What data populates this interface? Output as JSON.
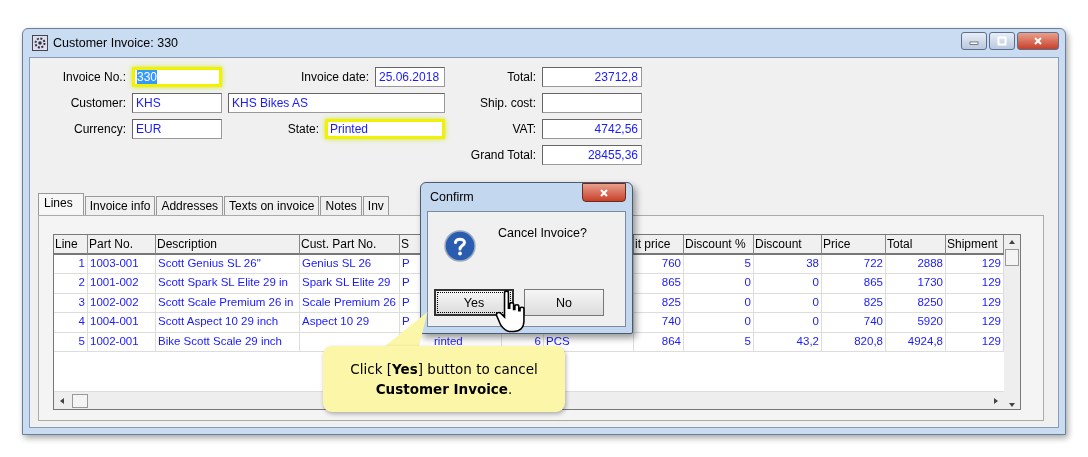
{
  "window": {
    "title": "Customer Invoice: 330"
  },
  "header": {
    "invoice_no": {
      "label": "Invoice No.:",
      "value": "330",
      "highlighted": true,
      "text_selected": true
    },
    "invoice_date": {
      "label": "Invoice date:",
      "value": "25.06.2018"
    },
    "customer": {
      "label": "Customer:",
      "code": "KHS",
      "name": "KHS Bikes AS"
    },
    "currency": {
      "label": "Currency:",
      "value": "EUR"
    },
    "state": {
      "label": "State:",
      "value": "Printed",
      "highlighted": true
    }
  },
  "totals": [
    {
      "label": "Total:",
      "value": "23712,8"
    },
    {
      "label": "Ship. cost:"
    },
    {
      "label": "VAT:",
      "value": "4742,56"
    },
    {
      "label": "Grand Total:",
      "value": "28455,36"
    }
  ],
  "tabs": [
    {
      "label": "Lines",
      "selected": true
    },
    {
      "label": "Invoice info",
      "selected": false
    },
    {
      "label": "Addresses",
      "selected": false
    },
    {
      "label": "Texts on invoice",
      "selected": false
    },
    {
      "label": "Notes",
      "selected": false
    },
    {
      "label": "Inv",
      "selected": false
    }
  ],
  "table": {
    "columns": [
      "Line",
      "Part No.",
      "Description",
      "Cust. Part No.",
      "S",
      null,
      null,
      "it price",
      "Discount %",
      "Discount",
      "Price",
      "Total",
      "Shipment"
    ],
    "rows": [
      [
        "1",
        "1003-001",
        "Scott Genius SL 26\"",
        "Genius SL 26",
        "P",
        null,
        null,
        "760",
        "5",
        "38",
        "722",
        "2888",
        "129"
      ],
      [
        "2",
        "1001-002",
        "Scott Spark SL Elite 29 in",
        "Spark SL Elite 29",
        "P",
        null,
        null,
        "865",
        "0",
        "0",
        "865",
        "1730",
        "129"
      ],
      [
        "3",
        "1002-002",
        "Scott Scale Premium 26 in",
        "Scale Premium 26",
        "P",
        null,
        null,
        "825",
        "0",
        "0",
        "825",
        "8250",
        "129"
      ],
      [
        "4",
        "1004-001",
        "Scott Aspect 10 29 inch",
        "Aspect 10 29",
        "P",
        null,
        null,
        "740",
        "0",
        "0",
        "740",
        "5920",
        "129"
      ],
      [
        "5",
        "1002-001",
        "Bike Scott Scale 29 inch",
        null,
        "rinted",
        "6",
        "PCS",
        "864",
        "5",
        "43,2",
        "820,8",
        "4924,8",
        "129"
      ]
    ]
  },
  "dialog": {
    "title": "Confirm",
    "message": "Cancel Invoice?",
    "buttons": [
      {
        "label": "Yes",
        "focused": true
      },
      {
        "label": "No",
        "focused": false
      }
    ]
  },
  "callout": {
    "text": "Click [**Yes**] button to cancel **Customer Invoice**."
  }
}
